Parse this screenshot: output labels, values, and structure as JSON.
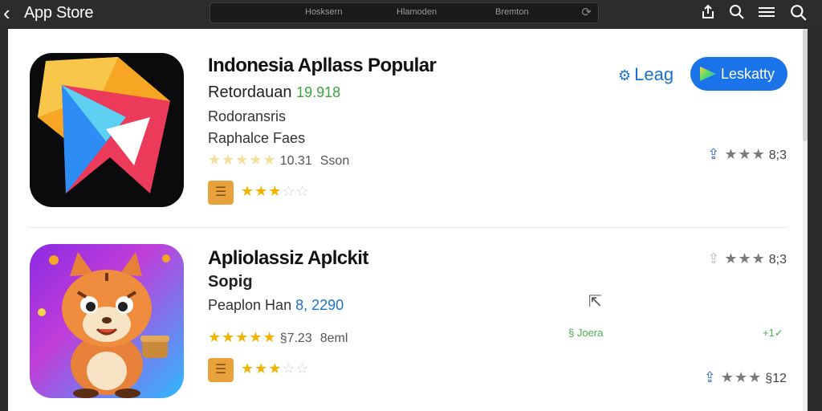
{
  "topbar": {
    "back_icon": "chevron-left-icon",
    "title": "App Store",
    "tabs": [
      "Hosksern",
      "Hlamoden",
      "Bremton"
    ],
    "refresh_icon": "refresh-icon",
    "icons": [
      "share-icon",
      "search-icon",
      "menu-icon",
      "search-icon"
    ]
  },
  "apps": [
    {
      "title": "Indonesia Apllass Popular",
      "subtitle": "Retordauan",
      "subtitle_value": "19.918",
      "developer": "Rodoransris",
      "category": "Raphalce Faes",
      "rating_value": "10.31",
      "rating_suffix": "Sson",
      "action_link": "Leag",
      "action_button": "Leskatty",
      "side_rating_1": "8;3"
    },
    {
      "title": "Apliolassiz Aplckit",
      "subtitle": "Sopig",
      "developer": "Peaplon Han",
      "developer_value": "8, 2290",
      "rating_value": "§7.23",
      "rating_suffix": "8eml",
      "side_rating_1": "8;3",
      "install_label": "§ Joera",
      "plus_label": "+1✓",
      "side_rating_2": "§12"
    }
  ],
  "colors": {
    "accent": "#1a73e8",
    "star": "#f0b400",
    "green": "#3aa53a"
  }
}
